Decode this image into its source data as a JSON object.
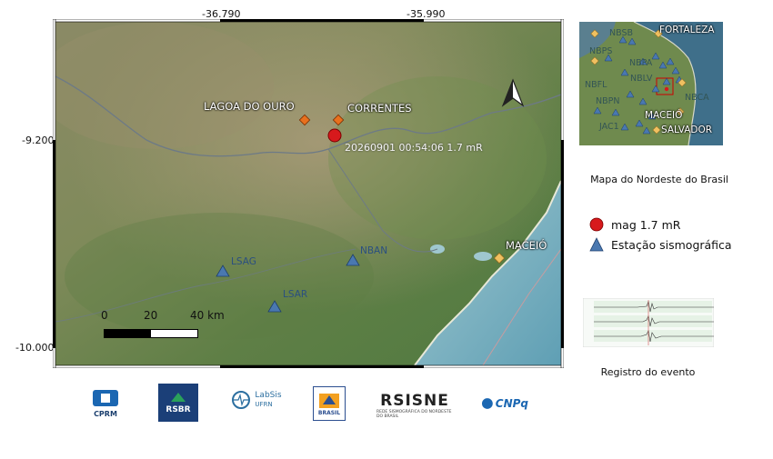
{
  "axes": {
    "x_top_labels": [
      "-36.790",
      "-35.990"
    ],
    "y_left_labels": [
      "-9.200",
      "-10.000"
    ]
  },
  "map": {
    "place_labels": {
      "lagoa": "LAGOA DO OURO",
      "correntes": "CORRENTES",
      "maceio": "MACEIÓ"
    },
    "event_label": "20260901 00:54:06 1.7 mR",
    "stations": {
      "lsag": "LSAG",
      "nban": "NBAN",
      "lsar": "LSAR"
    },
    "scalebar": {
      "l0": "0",
      "l1": "20",
      "l2": "40 km"
    },
    "colors": {
      "event": "#d7191c",
      "station": "#4a78b0",
      "city": "#f0c060",
      "city_orange": "#e8701e",
      "sea": "#7fb3c4"
    }
  },
  "inset": {
    "labels": {
      "fortaleza": "FORTALEZA",
      "maceio": "MACEIÓ",
      "salvador": "SALVADOR",
      "nbsb": "NBSB",
      "nbps": "NBPS",
      "nbpa": "NBPA",
      "nbfl": "NBFL",
      "nblv": "NBLV",
      "nbpn": "NBPN",
      "jac1": "JAC1",
      "nbca": "NBCA"
    },
    "caption": "Mapa do Nordeste do Brasil"
  },
  "legend": {
    "event": "mag 1.7 mR",
    "station": "Estação sismográfica"
  },
  "seismogram": {
    "caption": "Registro do evento"
  },
  "logos": {
    "cprm": "CPRM",
    "rsbr": "RSBR",
    "labsis": "LabSis",
    "labsis_sub": "UFRN",
    "rsisne": "RSISNE",
    "rsisne_sub": "REDE SISMOGRÁFICA DO NORDESTE DO BRASIL",
    "cnpq": "CNPq",
    "brasil": "BRASIL"
  }
}
